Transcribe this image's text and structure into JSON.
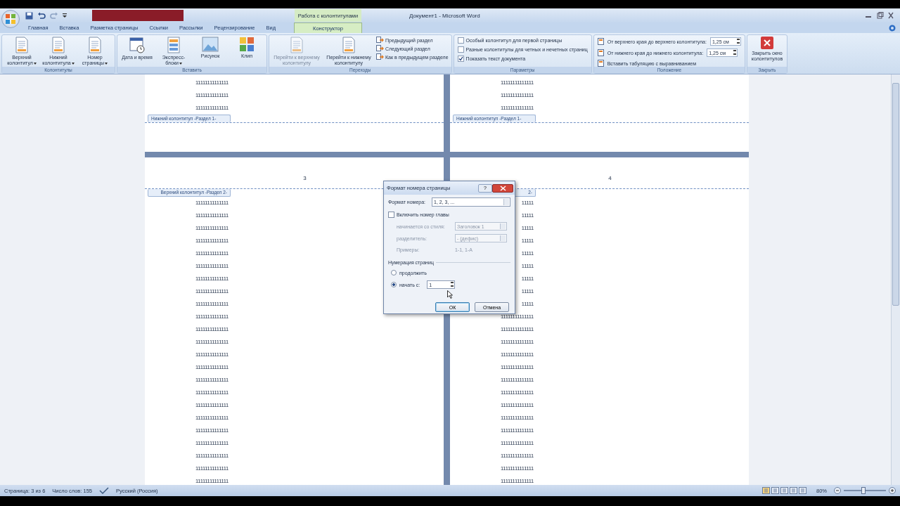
{
  "title_bar": {
    "context_tab": "Работа с колонтитулами",
    "title": "Документ1 - Microsoft Word"
  },
  "tabs": [
    {
      "label": "Главная",
      "selected": false
    },
    {
      "label": "Вставка",
      "selected": false
    },
    {
      "label": "Разметка страницы",
      "selected": false
    },
    {
      "label": "Ссылки",
      "selected": false
    },
    {
      "label": "Рассылки",
      "selected": false
    },
    {
      "label": "Рецензирование",
      "selected": false
    },
    {
      "label": "Вид",
      "selected": false
    },
    {
      "label": "Конструктор",
      "selected": true
    }
  ],
  "ribbon": [
    {
      "kind": "large",
      "label": "Колонтитулы",
      "buttons": [
        {
          "label": "Верхний колонтитул",
          "dropdown": true,
          "disabled": false
        },
        {
          "label": "Нижний колонтитула",
          "dropdown": true,
          "disabled": false
        },
        {
          "label": "Номер страницы",
          "dropdown": true,
          "disabled": false
        }
      ]
    },
    {
      "kind": "large",
      "label": "Вставить",
      "buttons": [
        {
          "label": "Дата и время",
          "dropdown": false,
          "disabled": false
        },
        {
          "label": "Экспресс-блоки",
          "dropdown": true,
          "disabled": false
        },
        {
          "label": "Рисунок",
          "dropdown": false,
          "disabled": false
        },
        {
          "label": "Клип",
          "dropdown": false,
          "disabled": false
        }
      ]
    },
    {
      "kind": "nav",
      "label": "Переходы",
      "buttons": [
        {
          "label": "Перейти к верхнему колонтитулу",
          "dropdown": false,
          "disabled": true
        },
        {
          "label": "Перейти к нижнему колонтитулу",
          "dropdown": false,
          "disabled": false
        }
      ],
      "small": [
        "Предыдущий раздел",
        "Следующий раздел",
        "Как в предыдущем разделе"
      ]
    },
    {
      "kind": "checks",
      "label": "Параметры",
      "checks": [
        {
          "label": "Особый колонтитул для первой страницы",
          "checked": false
        },
        {
          "label": "Разные колонтитулы для четных и нечетных страниц",
          "checked": false
        },
        {
          "label": "Показать текст документа",
          "checked": true
        }
      ]
    },
    {
      "kind": "position",
      "label": "Положение",
      "rows": [
        {
          "label": "От верхнего края до верхнего колонтитула:",
          "value": "1,25 см"
        },
        {
          "label": "От нижнего края до нижнего колонтитула:",
          "value": "1,25 см"
        },
        {
          "label": "Вставить табуляцию с выравниванием"
        }
      ]
    },
    {
      "kind": "close",
      "label": "Закрыть",
      "button": "Закрыть окно колонтитулов"
    }
  ],
  "pages": [
    {
      "kind": "footer",
      "label": "Нижний колонтитул -Раздел 1-",
      "lines": [
        "11111111111111",
        "11111111111111",
        "11111111111111"
      ]
    },
    {
      "kind": "footer",
      "label": "Нижний колонтитул -Раздел 1-",
      "lines": [
        "11111111111111",
        "11111111111111",
        "11111111111111"
      ]
    },
    {
      "kind": "header",
      "number": "3",
      "label": "Верхний колонтитул -Раздел 2-",
      "lines": [
        "11111111111111",
        "11111111111111",
        "11111111111111",
        "11111111111111",
        "11111111111111",
        "11111111111111",
        "11111111111111",
        "11111111111111",
        "11111111111111",
        "11111111111111",
        "11111111111111",
        "11111111111111",
        "11111111111111",
        "11111111111111",
        "11111111111111",
        "11111111111111",
        "11111111111111",
        "11111111111111",
        "11111111111111",
        "11111111111111",
        "11111111111111",
        "11111111111111",
        "11111111111111"
      ]
    },
    {
      "kind": "header",
      "number": "4",
      "label": "2-",
      "lines": [
        "11111",
        "11111",
        "11111",
        "11111",
        "11111",
        "11111",
        "11111",
        "11111",
        "11111",
        "11111111111111",
        "11111111111111",
        "11111111111111",
        "11111111111111",
        "11111111111111",
        "11111111111111",
        "11111111111111",
        "11111111111111",
        "11111111111111",
        "11111111111111",
        "11111111111111",
        "11111111111111",
        "11111111111111",
        "11111111111111"
      ]
    }
  ],
  "dialog": {
    "title": "Формат номера страницы",
    "help": "?",
    "format_label": "Формат номера:",
    "format_value": "1, 2, 3, ...",
    "chapter": {
      "label": "Включить номер главы",
      "checked": false
    },
    "fields": [
      {
        "label": "начинается со стиля:",
        "value": "Заголовок 1",
        "kind": "select",
        "disabled": true
      },
      {
        "label": "разделитель:",
        "value": "-    (дефис)",
        "kind": "select",
        "disabled": true
      },
      {
        "label": "Примеры:",
        "value": "1-1, 1-А",
        "kind": "text",
        "disabled": true
      }
    ],
    "group": "Нумерация страниц",
    "radios": [
      {
        "label": "продолжить",
        "selected": false
      },
      {
        "label": "начать с:",
        "selected": true,
        "value": "1"
      }
    ],
    "buttons": [
      "ОК",
      "Отмена"
    ]
  },
  "status_bar": {
    "page": "Страница: 3 из 6",
    "words": "Число слов: 155",
    "language": "Русский (Россия)",
    "zoom": "80%",
    "zoom_slider": {
      "level": 0.45
    }
  }
}
